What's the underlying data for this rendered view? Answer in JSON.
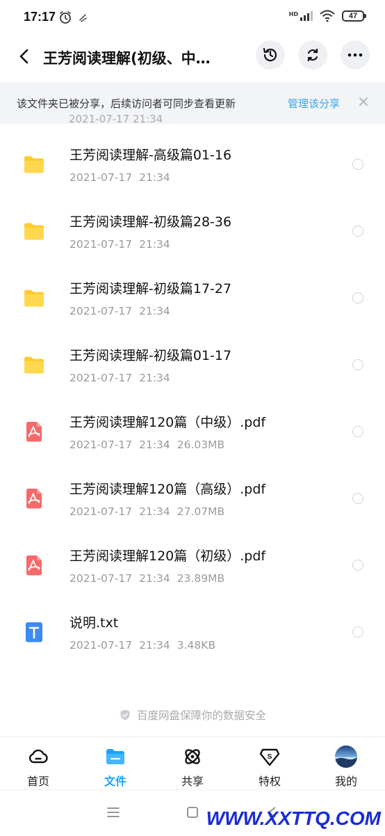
{
  "status": {
    "time": "17:17",
    "battery": "47",
    "network": "HD"
  },
  "header": {
    "title": "王芳阅读理解(初级、中…"
  },
  "banner": {
    "text": "该文件夹已被分享，后续访问者可同步查看更新",
    "link": "管理该分享"
  },
  "partial_row_text": "2021-07-17  21:34",
  "files": [
    {
      "type": "folder",
      "name": "王芳阅读理解-高级篇01-16",
      "date": "2021-07-17",
      "time": "21:34",
      "size": ""
    },
    {
      "type": "folder",
      "name": "王芳阅读理解-初级篇28-36",
      "date": "2021-07-17",
      "time": "21:34",
      "size": ""
    },
    {
      "type": "folder",
      "name": "王芳阅读理解-初级篇17-27",
      "date": "2021-07-17",
      "time": "21:34",
      "size": ""
    },
    {
      "type": "folder",
      "name": "王芳阅读理解-初级篇01-17",
      "date": "2021-07-17",
      "time": "21:34",
      "size": ""
    },
    {
      "type": "pdf",
      "name": "王芳阅读理解120篇（中级）.pdf",
      "date": "2021-07-17",
      "time": "21:34",
      "size": "26.03MB"
    },
    {
      "type": "pdf",
      "name": "王芳阅读理解120篇（高级）.pdf",
      "date": "2021-07-17",
      "time": "21:34",
      "size": "27.07MB"
    },
    {
      "type": "pdf",
      "name": "王芳阅读理解120篇（初级）.pdf",
      "date": "2021-07-17",
      "time": "21:34",
      "size": "23.89MB"
    },
    {
      "type": "txt",
      "name": "说明.txt",
      "date": "2021-07-17",
      "time": "21:34",
      "size": "3.48KB"
    }
  ],
  "footer_note": "百度网盘保障你的数据安全",
  "nav": [
    {
      "label": "首页",
      "icon": "cloud-icon",
      "active": false
    },
    {
      "label": "文件",
      "icon": "folder-icon",
      "active": true
    },
    {
      "label": "共享",
      "icon": "atom-share-icon",
      "active": false
    },
    {
      "label": "特权",
      "icon": "vip-shield-icon",
      "active": false
    },
    {
      "label": "我的",
      "icon": "avatar",
      "active": false
    }
  ],
  "watermark": "WWW.XXTTQ.COM",
  "colors": {
    "accent": "#1aa3ff",
    "link": "#3ba6e8",
    "folder": "#ffd23e",
    "pdf": "#f46a6a",
    "txt": "#3c8bf0"
  }
}
